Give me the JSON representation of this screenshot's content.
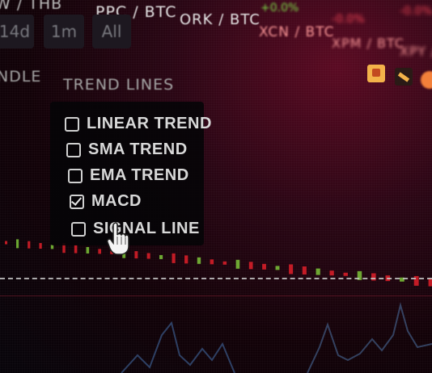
{
  "top_pairs": [
    {
      "label": "W / THB"
    },
    {
      "label": "PPC / BTC"
    },
    {
      "label": "ORK / BTC"
    },
    {
      "label": "XCN / BTC"
    },
    {
      "label": "XPM / BTC"
    },
    {
      "label": "XPY / B"
    }
  ],
  "ticker_values": [
    "+0.0%",
    "-0.0%",
    "-0.0%"
  ],
  "time_range_buttons": [
    "14d",
    "1m",
    "All"
  ],
  "sections": {
    "candle_label": "NDLE",
    "trend_lines_label": "TREND LINES"
  },
  "trend_options": [
    {
      "label": "LINEAR TREND",
      "checked": false
    },
    {
      "label": "SMA TREND",
      "checked": false
    },
    {
      "label": "EMA TREND",
      "checked": false
    },
    {
      "label": "MACD",
      "checked": true
    },
    {
      "label": "SIGNAL LINE",
      "checked": false
    }
  ],
  "colors": {
    "background": "#120208",
    "accent_red": "#e0202a",
    "accent_green": "#7cc43a",
    "panel": "#050507",
    "text": "#d8d8d8"
  },
  "icons": [
    "checkbox-icon",
    "hand-pointer-icon",
    "lamp-icon",
    "pencil-icon"
  ]
}
